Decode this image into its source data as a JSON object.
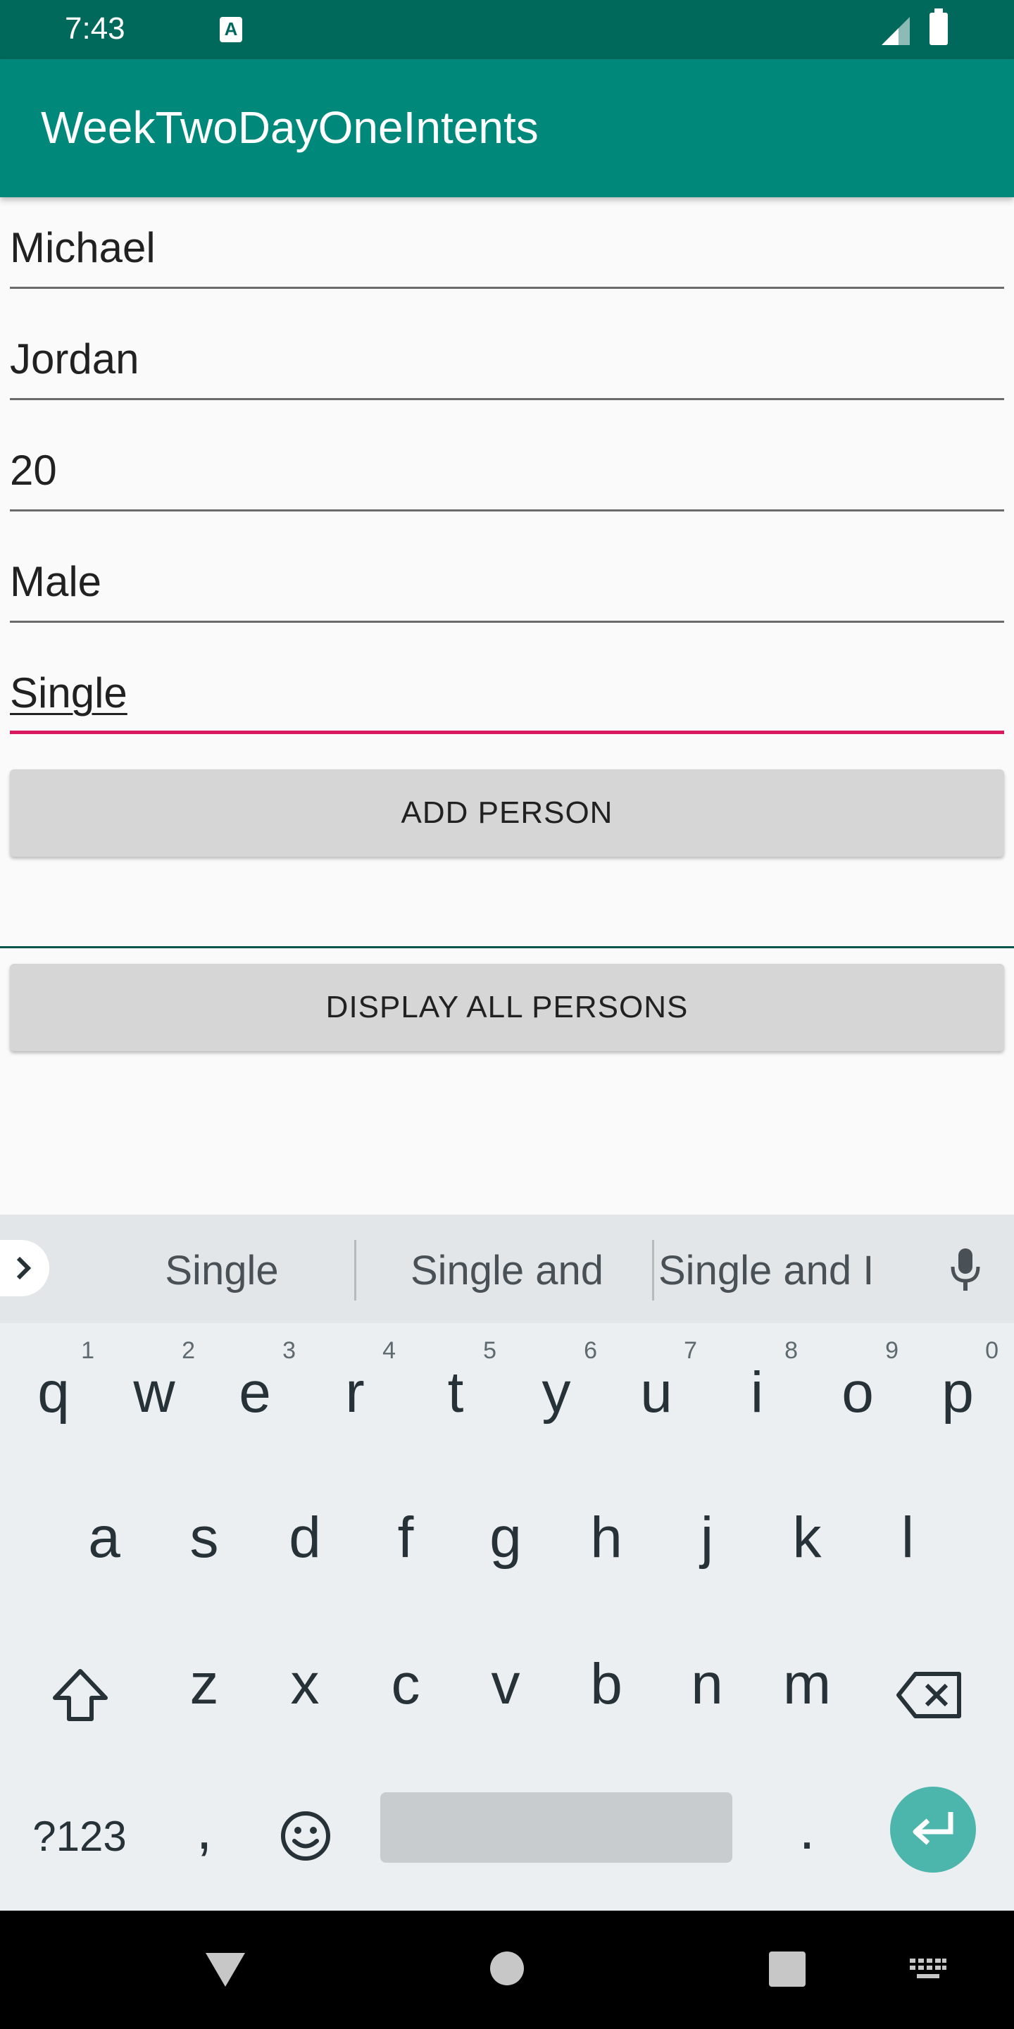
{
  "status_bar": {
    "time": "7:43",
    "badge": "A"
  },
  "app_bar": {
    "title": "WeekTwoDayOneIntents"
  },
  "form": {
    "fields": [
      {
        "value": "Michael"
      },
      {
        "value": "Jordan"
      },
      {
        "value": "20"
      },
      {
        "value": "Male"
      },
      {
        "value": "Single"
      }
    ],
    "add_button_label": "ADD PERSON",
    "display_button_label": "DISPLAY ALL PERSONS"
  },
  "keyboard": {
    "suggestions": [
      "Single",
      "Single and",
      "Single and I"
    ],
    "row1": [
      "q",
      "w",
      "e",
      "r",
      "t",
      "y",
      "u",
      "i",
      "o",
      "p"
    ],
    "row1_hints": [
      "1",
      "2",
      "3",
      "4",
      "5",
      "6",
      "7",
      "8",
      "9",
      "0"
    ],
    "row2": [
      "a",
      "s",
      "d",
      "f",
      "g",
      "h",
      "j",
      "k",
      "l"
    ],
    "row3": [
      "z",
      "x",
      "c",
      "v",
      "b",
      "n",
      "m"
    ],
    "symbols_label": "?123",
    "comma": ",",
    "period": "."
  },
  "colors": {
    "status_bar": "#00695c",
    "app_bar": "#00897b",
    "focus_underline": "#d81b60",
    "enter_key": "#4db6ac"
  }
}
